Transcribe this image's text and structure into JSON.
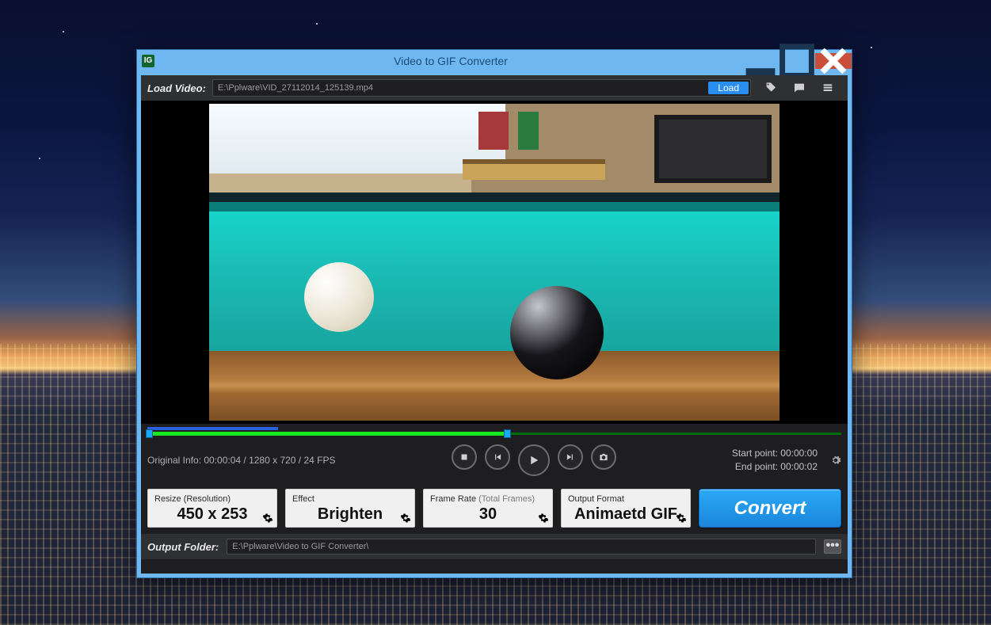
{
  "window": {
    "title": "Video to GIF Converter",
    "app_icon_text": "IG"
  },
  "load": {
    "label": "Load Video:",
    "path": "E:\\Pplware\\VID_27112014_125139.mp4",
    "button": "Load"
  },
  "timeline": {
    "info_prefix": "Original Info: ",
    "info": "00:00:04 / 1280 x 720 / 24 FPS",
    "start_label": "Start point: ",
    "start_value": "00:00:00",
    "end_label": "End point: ",
    "end_value": "00:00:02"
  },
  "cards": {
    "resize": {
      "title": "Resize (Resolution)",
      "value": "450 x 253"
    },
    "effect": {
      "title": "Effect",
      "value": "Brighten"
    },
    "framerate": {
      "title": "Frame Rate ",
      "title_muted": "(Total Frames)",
      "value": "30"
    },
    "format": {
      "title": "Output Format",
      "value": "Animaetd GIF"
    }
  },
  "convert_label": "Convert",
  "output": {
    "label": "Output Folder:",
    "path": "E:\\Pplware\\Video to GIF Converter\\",
    "browse": "•••"
  }
}
